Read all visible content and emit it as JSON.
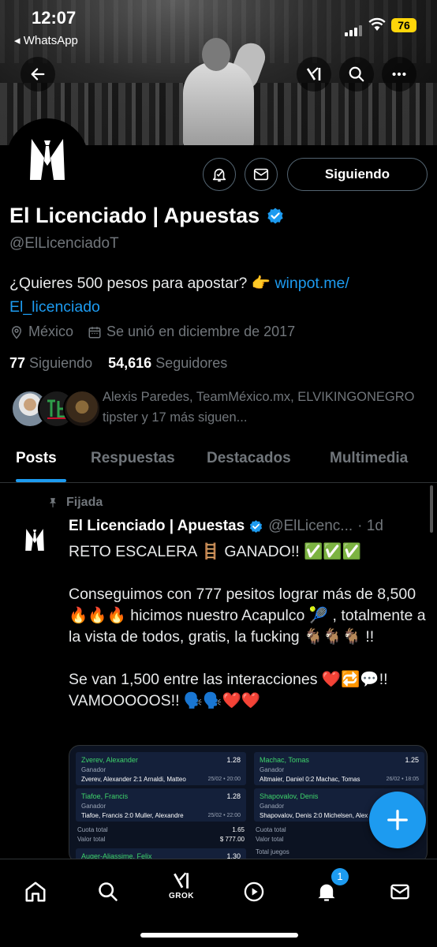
{
  "status_bar": {
    "time": "12:07",
    "back_app": "◂ WhatsApp",
    "battery": "76",
    "battery_color": "#ffd60a"
  },
  "header": {
    "back_icon": "arrow-left-icon",
    "grok_icon": "grok-icon",
    "search_icon": "search-icon",
    "more_icon": "more-icon"
  },
  "profile": {
    "name": "El Licenciado | Apuestas",
    "handle": "@ElLicenciadoT",
    "bio_text": "¿Quieres 500 pesos para apostar? 👉 ",
    "bio_link_1": "winpot.me/",
    "bio_link_2": "El_licenciado",
    "location": "México",
    "joined": "Se unió en diciembre de 2017",
    "following_count": "77",
    "following_label": "Siguiendo",
    "followers_count": "54,616",
    "followers_label": "Seguidores",
    "known_followers": "Alexis Paredes, TeamMéxico.mx, ELVIKINGONEGRO tipster y 17 más siguen..."
  },
  "actions": {
    "follow_label": "Siguiendo"
  },
  "tabs": [
    {
      "label": "Posts"
    },
    {
      "label": "Respuestas"
    },
    {
      "label": "Destacados"
    },
    {
      "label": "Multimedia"
    }
  ],
  "post": {
    "pinned_label": "Fijada",
    "author_name": "El Licenciado | Apuestas",
    "author_handle": "@ElLicenc...",
    "time": "· 1d",
    "text": "RETO ESCALERA 🪜 GANADO!! ✅✅✅\n\nConseguimos con 777 pesitos lograr más de 8,500 🔥🔥🔥 hicimos nuestro Acapulco 🎾 , totalmente a la vista de todos, gratis, la fucking 🐐🐐🐐 !!\n\nSe van 1,500 entre las interacciones ❤️🔁💬!! VAMOOOOOS!! 🗣️🗣️❤️❤️",
    "slip_left": {
      "bets": [
        {
          "name": "Zverev, Alexander",
          "odds": "1.28",
          "label": "Ganador",
          "score": "Zverev, Alexander 2:1 Arnaldi, Matteo",
          "date": "25/02 • 20:00"
        },
        {
          "name": "Tiafoe, Francis",
          "odds": "1.28",
          "label": "Ganador",
          "score": "Tiafoe, Francis 2:0 Muller, Alexandre",
          "date": "25/02 • 22:00"
        }
      ],
      "cuota_label": "Cuota total",
      "cuota_value": "1.65",
      "valor_label": "Valor total",
      "valor_value": "$ 777.00",
      "next_name": "Auger-Aliassime, Felix",
      "next_odds": "1.30"
    },
    "slip_right": {
      "bets": [
        {
          "name": "Machac, Tomas",
          "odds": "1.25",
          "label": "Ganador",
          "score": "Altmaier, Daniel 0:2 Machac, Tomas",
          "date": "26/02 • 18:05"
        },
        {
          "name": "Shapovalov, Denis",
          "odds": "",
          "label": "Ganador",
          "score": "Shapovalov, Denis 2:0 Michelsen, Alex",
          "date": ""
        }
      ],
      "cuota_label": "Cuota total",
      "valor_label": "Valor total",
      "extra_label": "Total juegos"
    }
  },
  "bottom_nav": {
    "grok_label": "GROK",
    "notification_badge": "1"
  },
  "colors": {
    "accent": "#1d9bf0",
    "background": "#000000",
    "muted_text": "#71767b"
  }
}
